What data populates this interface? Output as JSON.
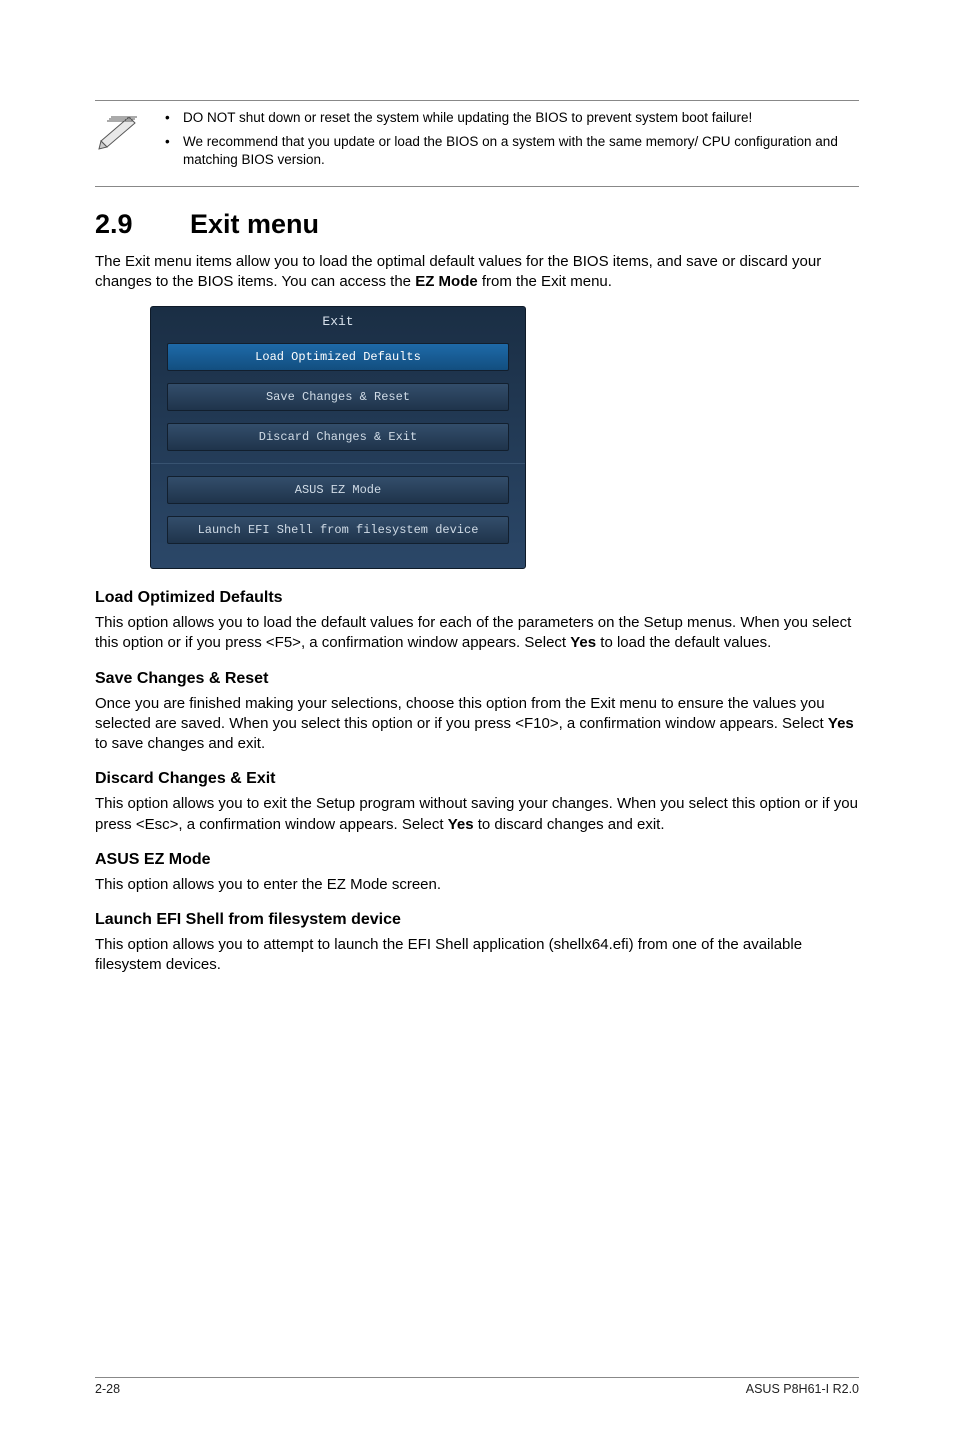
{
  "notes": {
    "bullet1": "DO NOT shut down or reset the system while updating the BIOS to prevent system boot failure!",
    "bullet2": "We recommend that you update or load the BIOS on a system with the same memory/ CPU configuration and matching BIOS version."
  },
  "section": {
    "number": "2.9",
    "title": "Exit menu",
    "intro_pre": "The Exit menu items allow you to load the optimal default values for the BIOS items, and save or discard your changes to the BIOS items. You can access the ",
    "intro_bold": "EZ Mode",
    "intro_post": " from the Exit menu."
  },
  "bios": {
    "title": "Exit",
    "btn1": "Load Optimized Defaults",
    "btn2": "Save Changes & Reset",
    "btn3": "Discard Changes & Exit",
    "btn4": "ASUS EZ Mode",
    "btn5": "Launch EFI Shell from filesystem device"
  },
  "subs": {
    "lod": {
      "h": "Load Optimized Defaults",
      "p_pre": "This option allows you to load the default values for each of the parameters on the Setup menus. When you select this option or if you press <F5>, a confirmation window appears. Select ",
      "p_bold": "Yes",
      "p_post": " to load the default values."
    },
    "scr": {
      "h": "Save Changes & Reset",
      "p_pre": "Once you are finished making your selections, choose this option from the Exit menu to ensure the values you selected are saved. When you select this option or if you press <F10>, a confirmation window appears. Select ",
      "p_bold": "Yes",
      "p_post": " to save changes and exit."
    },
    "dce": {
      "h": "Discard Changes & Exit",
      "p_pre": "This option allows you to exit the Setup program without saving your changes. When you select this option or if you press <Esc>, a confirmation window appears. Select ",
      "p_bold": "Yes",
      "p_post": " to discard changes and exit."
    },
    "ez": {
      "h": "ASUS EZ Mode",
      "p": "This option allows you to enter the EZ Mode screen."
    },
    "efi": {
      "h": "Launch EFI Shell from filesystem device",
      "p": "This option allows you to attempt to launch the EFI Shell application (shellx64.efi) from one of the available filesystem devices."
    }
  },
  "footer": {
    "left": "2-28",
    "right": "ASUS P8H61-I R2.0"
  }
}
